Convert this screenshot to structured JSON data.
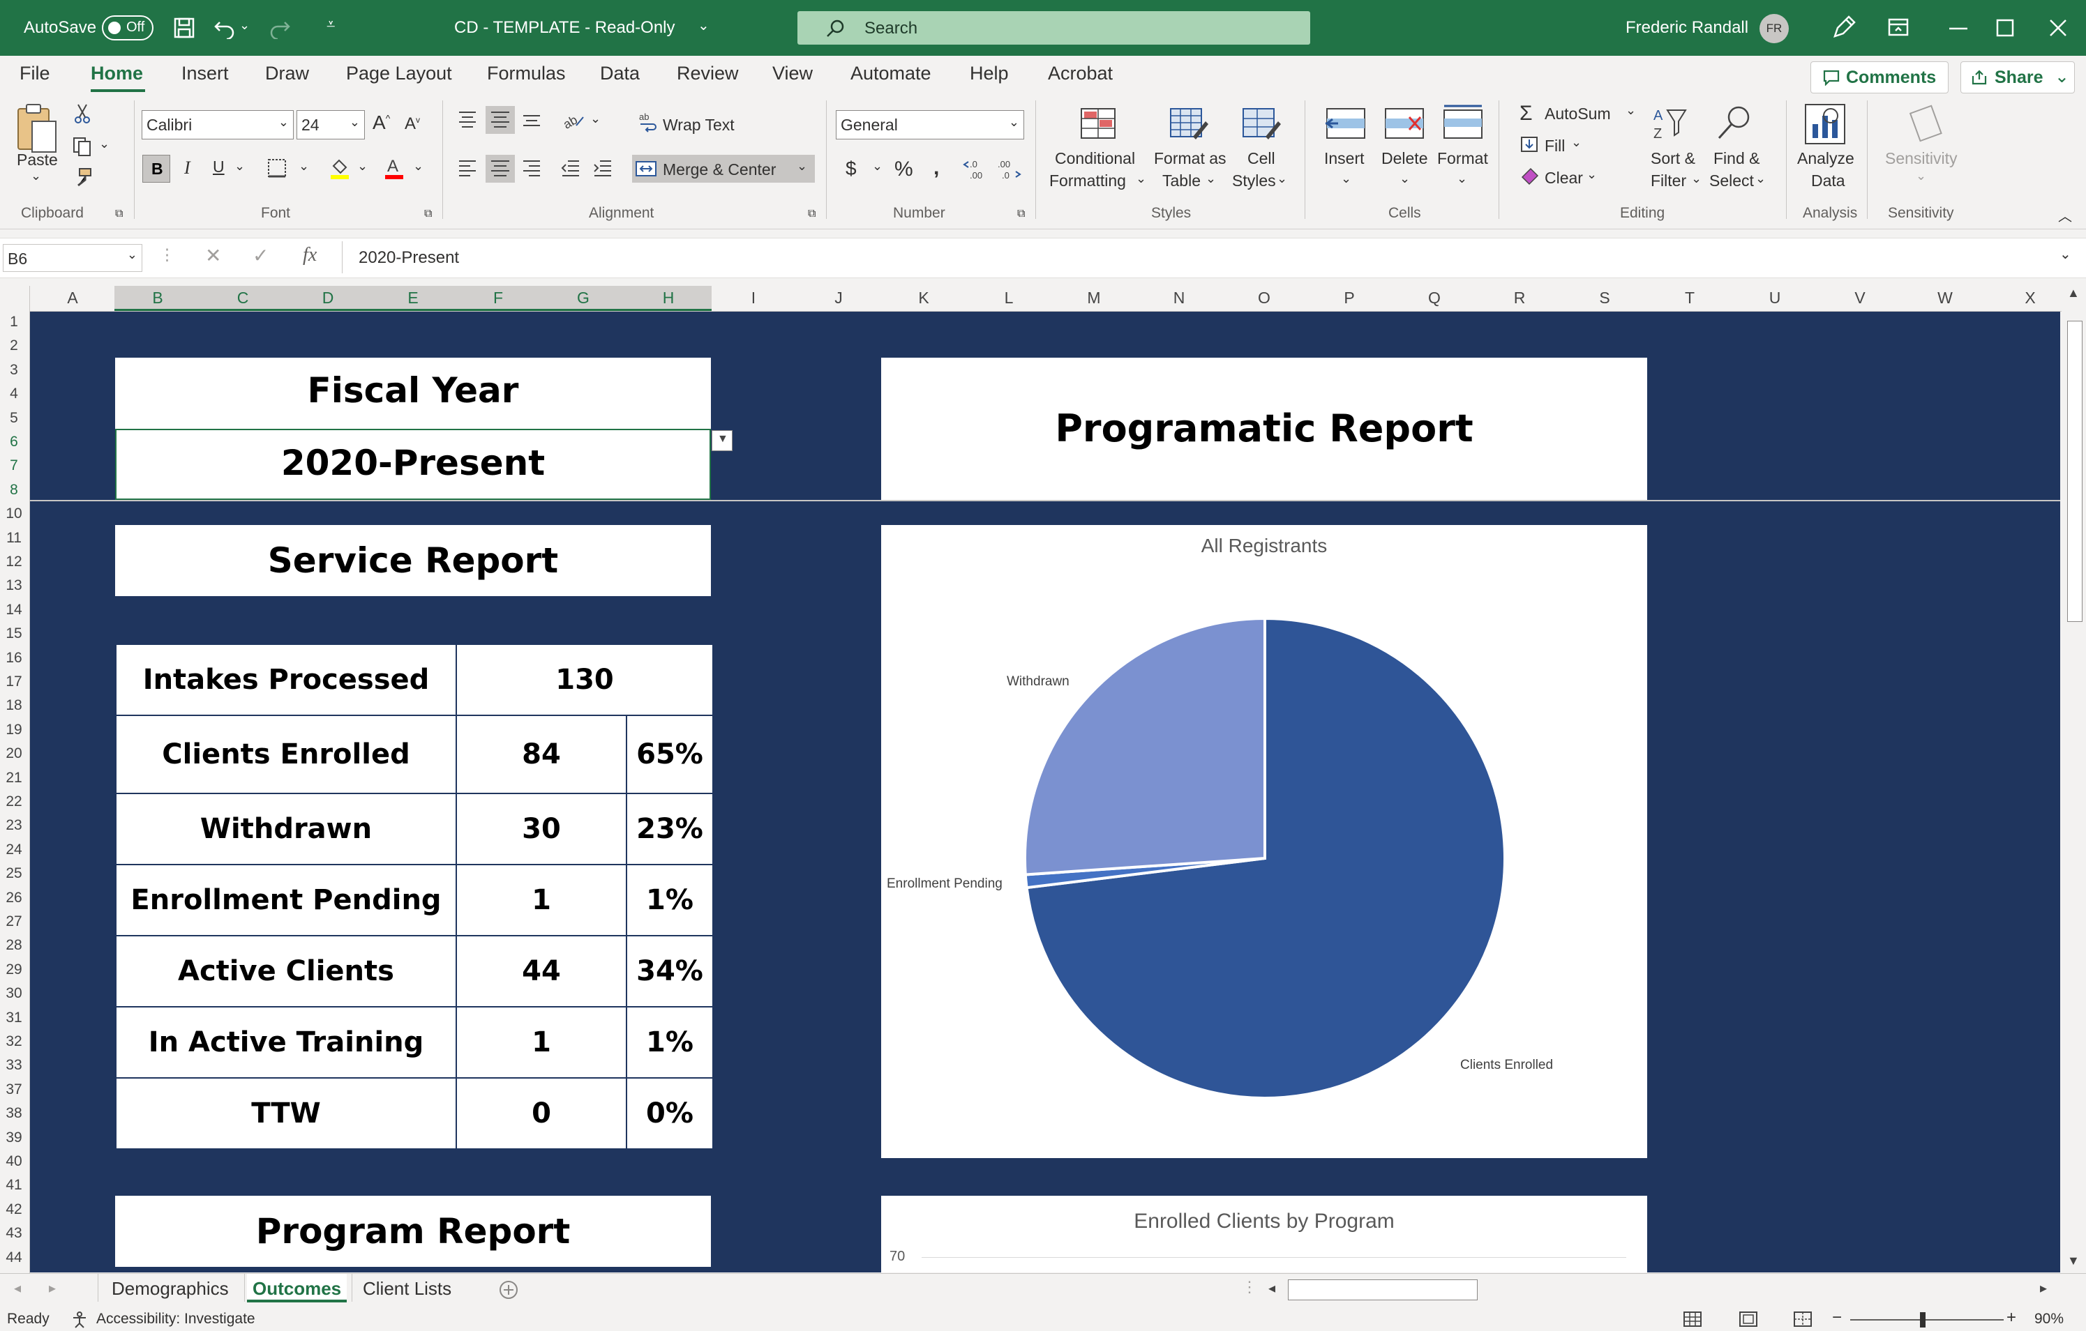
{
  "titlebar": {
    "autosave_label": "AutoSave",
    "autosave_state": "Off",
    "document_title": "CD - TEMPLATE  -  Read-Only",
    "search_placeholder": "Search",
    "user_name": "Frederic Randall",
    "user_initials": "FR"
  },
  "ribbon_tabs": [
    "File",
    "Home",
    "Insert",
    "Draw",
    "Page Layout",
    "Formulas",
    "Data",
    "Review",
    "View",
    "Automate",
    "Help",
    "Acrobat"
  ],
  "comments_label": "Comments",
  "share_label": "Share",
  "ribbon": {
    "clipboard": {
      "paste": "Paste",
      "group": "Clipboard"
    },
    "font": {
      "name": "Calibri",
      "size": "24",
      "bold": "B",
      "italic": "I",
      "underline": "U",
      "group": "Font"
    },
    "alignment": {
      "wrap_text": "Wrap Text",
      "merge_center": "Merge & Center",
      "group": "Alignment"
    },
    "number": {
      "format": "General",
      "currency": "$",
      "percent": "%",
      "comma": "9",
      "group": "Number"
    },
    "styles": {
      "conditional_1": "Conditional",
      "conditional_2": "Formatting",
      "format_table_1": "Format as",
      "format_table_2": "Table",
      "cell_styles_1": "Cell",
      "cell_styles_2": "Styles",
      "group": "Styles"
    },
    "cells": {
      "insert": "Insert",
      "delete": "Delete",
      "format": "Format",
      "group": "Cells"
    },
    "editing": {
      "autosum": "AutoSum",
      "fill": "Fill",
      "clear": "Clear",
      "sort_1": "Sort &",
      "sort_2": "Filter",
      "find_1": "Find &",
      "find_2": "Select",
      "group": "Editing"
    },
    "analysis": {
      "analyze_1": "Analyze",
      "analyze_2": "Data",
      "group": "Analysis"
    },
    "sensitivity": {
      "label": "Sensitivity",
      "group": "Sensitivity"
    }
  },
  "formula_bar": {
    "name_box": "B6",
    "fx": "fx",
    "value": "2020-Present"
  },
  "columns": [
    "A",
    "B",
    "C",
    "D",
    "E",
    "F",
    "G",
    "H",
    "I",
    "J",
    "K",
    "L",
    "M",
    "N",
    "O",
    "P",
    "Q",
    "R",
    "S",
    "T",
    "U",
    "V",
    "W",
    "X"
  ],
  "rows": [
    "1",
    "2",
    "3",
    "4",
    "5",
    "6",
    "7",
    "8",
    "10",
    "11",
    "12",
    "13",
    "14",
    "15",
    "16",
    "17",
    "18",
    "19",
    "20",
    "21",
    "22",
    "23",
    "24",
    "25",
    "26",
    "27",
    "28",
    "29",
    "30",
    "31",
    "32",
    "33",
    "37",
    "38",
    "39",
    "40",
    "41",
    "42",
    "43",
    "44"
  ],
  "sheet": {
    "fiscal_year_title": "Fiscal Year",
    "fiscal_year_value": "2020-Present",
    "programatic_title": "Programatic Report",
    "service_title": "Service Report",
    "program_title": "Program Report",
    "service_rows": [
      {
        "label": "Intakes Processed",
        "count": "130",
        "pct": ""
      },
      {
        "label": "Clients Enrolled",
        "count": "84",
        "pct": "65%"
      },
      {
        "label": "Withdrawn",
        "count": "30",
        "pct": "23%"
      },
      {
        "label": "Enrollment Pending",
        "count": "1",
        "pct": "1%"
      },
      {
        "label": "Active Clients",
        "count": "44",
        "pct": "34%"
      },
      {
        "label": "In Active Training",
        "count": "1",
        "pct": "1%"
      },
      {
        "label": "TTW",
        "count": "0",
        "pct": "0%"
      }
    ]
  },
  "chart_data": [
    {
      "type": "pie",
      "title": "All Registrants",
      "categories": [
        "Clients Enrolled",
        "Enrollment Pending",
        "Withdrawn"
      ],
      "values": [
        84,
        1,
        30
      ],
      "colors": [
        "#2f5597",
        "#4472c4",
        "#7b91d0"
      ]
    },
    {
      "type": "bar",
      "title": "Enrolled Clients by Program",
      "ytick_visible": "70",
      "categories": [],
      "values": []
    }
  ],
  "sheet_tabs": [
    "Demographics",
    "Outcomes",
    "Client Lists"
  ],
  "status": {
    "ready": "Ready",
    "accessibility": "Accessibility: Investigate",
    "zoom": "90%"
  }
}
